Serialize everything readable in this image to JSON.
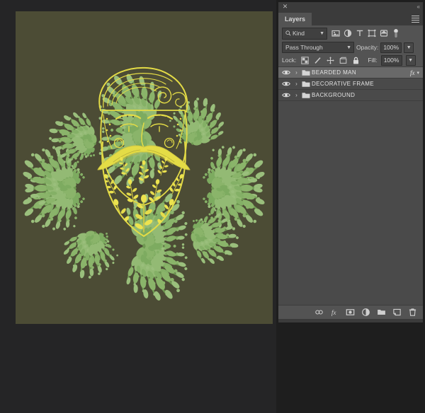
{
  "app": {
    "panel_bg": "#535353",
    "list_bg": "#4a4a4a",
    "selected_row_bg": "#696969",
    "text_color": "#e2e2e2"
  },
  "canvas": {
    "backdrop_color": "#252526",
    "artboard_color": "#4c4c35",
    "artwork": {
      "title": "Bearded Man Mandala",
      "foliage_color": "#7fa85f",
      "foliage_light_color": "#9cbf7e",
      "line_color": "#e4dc46",
      "beard_fill": "#d8d04a"
    }
  },
  "panel": {
    "title_tab": "Layers",
    "close_icon": "close-icon",
    "collapse_icon": "collapse-panel-icon",
    "menu_icon": "panel-menu-icon",
    "filter": {
      "search_icon": "search-icon",
      "kind_label": "Kind",
      "kind_chevron": "chevron-down-icon",
      "icons": [
        {
          "name": "filter-pixel-layers-icon"
        },
        {
          "name": "filter-adjustment-layers-icon"
        },
        {
          "name": "filter-type-layers-icon"
        },
        {
          "name": "filter-shape-layers-icon"
        },
        {
          "name": "filter-smart-object-layers-icon"
        }
      ],
      "toggle_name": "filter-enable-toggle"
    },
    "blend": {
      "mode": "Pass Through",
      "mode_chevron": "chevron-down-icon",
      "opacity_label": "Opacity:",
      "opacity_value": "100%",
      "opacity_chevron": "chevron-down-icon"
    },
    "lock": {
      "label": "Lock:",
      "icons": [
        {
          "name": "lock-transparent-pixels-icon"
        },
        {
          "name": "lock-image-pixels-icon"
        },
        {
          "name": "lock-position-icon"
        },
        {
          "name": "lock-artboard-nesting-icon"
        },
        {
          "name": "lock-all-icon"
        }
      ],
      "fill_label": "Fill:",
      "fill_value": "100%",
      "fill_chevron": "chevron-down-icon"
    },
    "layers": [
      {
        "name": "BEARDED MAN",
        "visible": true,
        "selected": true,
        "type": "group",
        "expanded": false,
        "has_effects": true,
        "fx_label": "fx"
      },
      {
        "name": "DECORATIVE FRAME",
        "visible": true,
        "selected": false,
        "type": "group",
        "expanded": false,
        "has_effects": false,
        "fx_label": ""
      },
      {
        "name": "BACKGROUND",
        "visible": true,
        "selected": false,
        "type": "group",
        "expanded": false,
        "has_effects": false,
        "fx_label": ""
      }
    ],
    "footer_buttons": [
      {
        "name": "link-layers-button"
      },
      {
        "name": "add-layer-style-button"
      },
      {
        "name": "add-layer-mask-button"
      },
      {
        "name": "new-adjustment-layer-button"
      },
      {
        "name": "new-group-button"
      },
      {
        "name": "new-layer-button"
      },
      {
        "name": "delete-layer-button"
      }
    ]
  }
}
